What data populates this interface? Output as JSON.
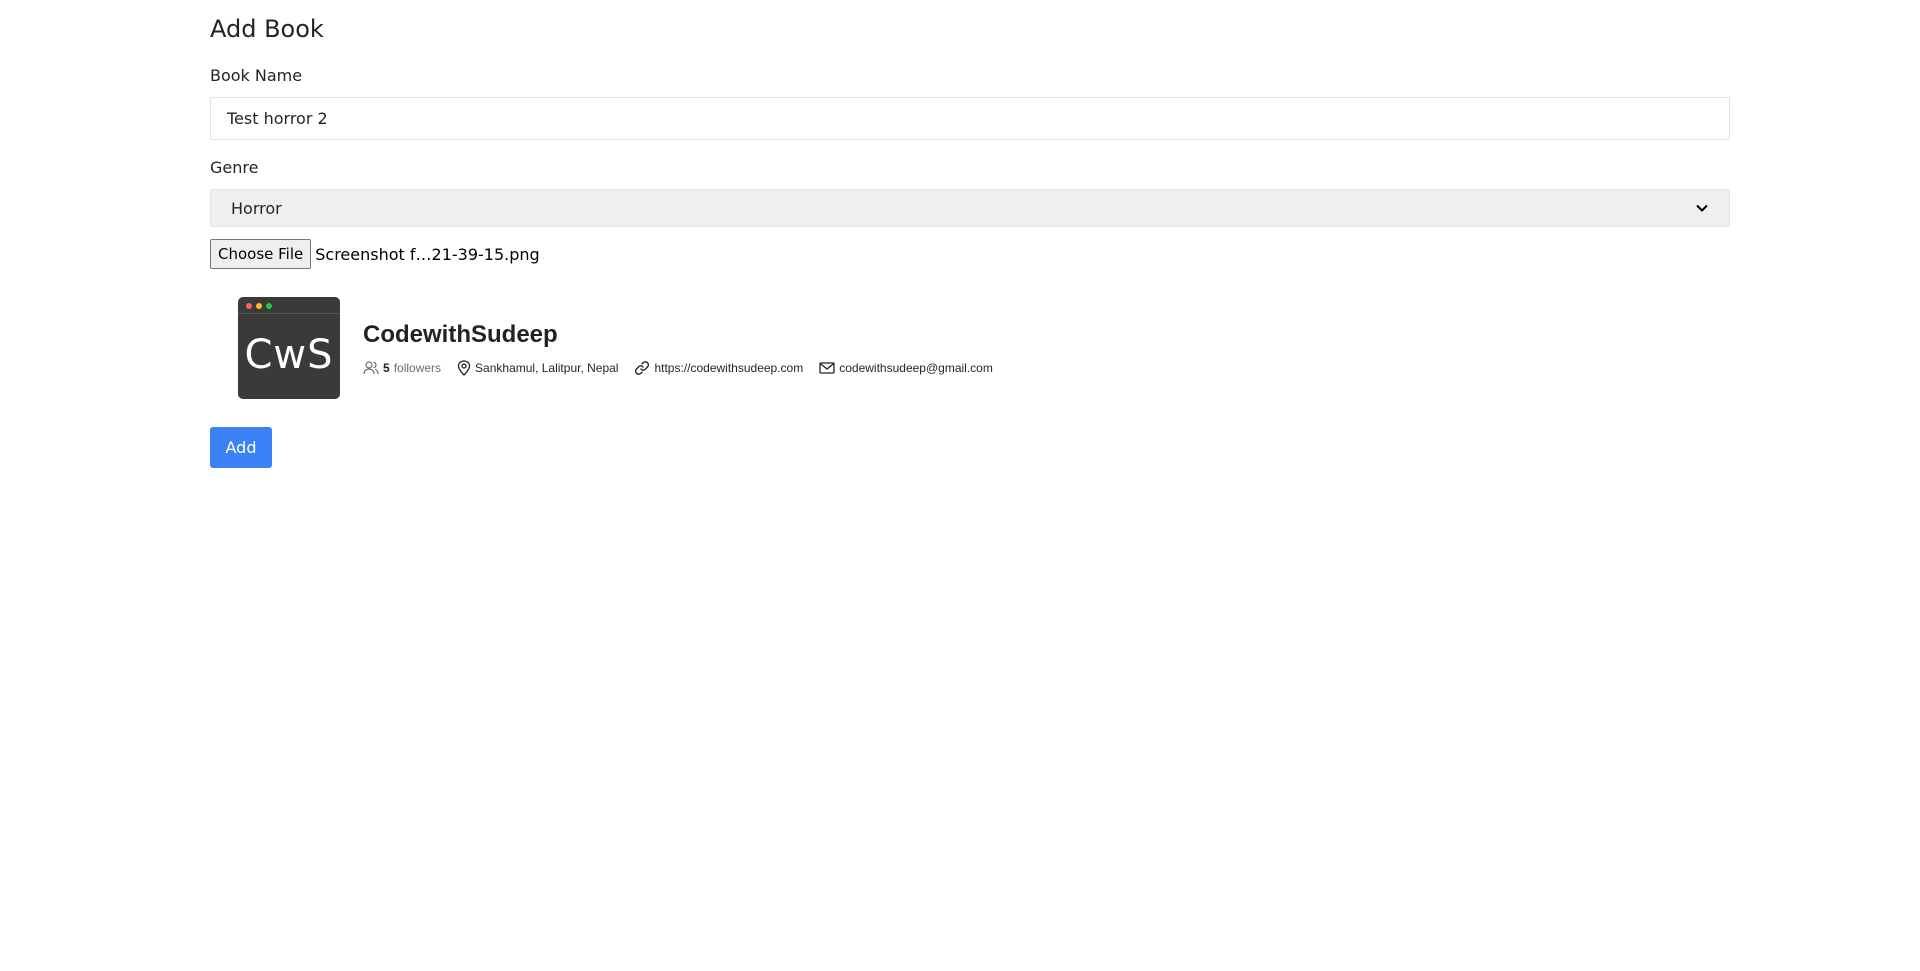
{
  "page": {
    "title": "Add Book"
  },
  "form": {
    "book_name_label": "Book Name",
    "book_name_value": "Test horror 2",
    "genre_label": "Genre",
    "genre_selected": "Horror",
    "file_button_label": "Choose File",
    "file_name": "Screenshot f…21-39-15.png",
    "submit_label": "Add"
  },
  "profile": {
    "avatar_text": "CwS",
    "name": "CodewithSudeep",
    "followers_count": "5",
    "followers_label": "followers",
    "location": "Sankhamul, Lalitpur, Nepal",
    "website": "https://codewithsudeep.com",
    "email": "codewithsudeep@gmail.com"
  },
  "colors": {
    "accent": "#3b82f6",
    "avatar_bg": "#3a3a3a",
    "dot_red": "#ff5f56",
    "dot_yellow": "#ffbd2e",
    "dot_green": "#27c93f"
  },
  "icons": {
    "followers": "people-icon",
    "location": "location-pin-icon",
    "website": "link-icon",
    "email": "mail-icon",
    "select": "chevron-down-icon"
  }
}
